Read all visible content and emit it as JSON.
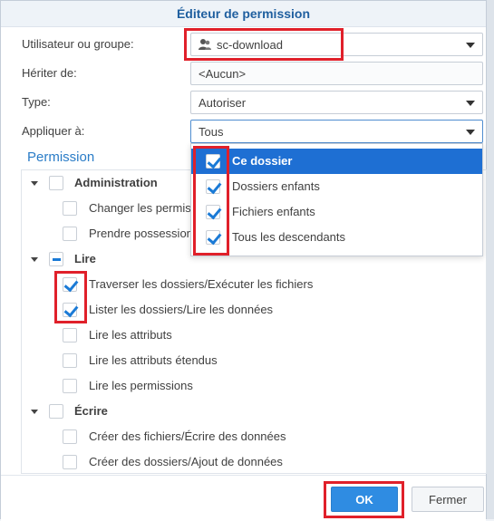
{
  "dialog": {
    "title": "Éditeur de permission"
  },
  "form": {
    "user_label": "Utilisateur ou groupe:",
    "user_value": "sc-download",
    "inherit_label": "Hériter de:",
    "inherit_value": "<Aucun>",
    "type_label": "Type:",
    "type_value": "Autoriser",
    "apply_label": "Appliquer à:",
    "apply_value": "Tous"
  },
  "apply_options": [
    {
      "label": "Ce dossier",
      "checked": true,
      "selected": true
    },
    {
      "label": "Dossiers enfants",
      "checked": true
    },
    {
      "label": "Fichiers enfants",
      "checked": true
    },
    {
      "label": "Tous les descendants",
      "checked": true
    }
  ],
  "permission": {
    "section_title": "Permission",
    "groups": [
      {
        "label": "Administration",
        "state": "unchecked",
        "items": [
          {
            "label": "Changer les permissions",
            "checked": false
          },
          {
            "label": "Prendre possession",
            "checked": false
          }
        ]
      },
      {
        "label": "Lire",
        "state": "partial",
        "items": [
          {
            "label": "Traverser les dossiers/Exécuter les fichiers",
            "checked": true
          },
          {
            "label": "Lister les dossiers/Lire les données",
            "checked": true
          },
          {
            "label": "Lire les attributs",
            "checked": false
          },
          {
            "label": "Lire les attributs étendus",
            "checked": false
          },
          {
            "label": "Lire les permissions",
            "checked": false
          }
        ]
      },
      {
        "label": "Écrire",
        "state": "unchecked",
        "items": [
          {
            "label": "Créer des fichiers/Écrire des données",
            "checked": false
          },
          {
            "label": "Créer des dossiers/Ajout de données",
            "checked": false
          }
        ]
      }
    ]
  },
  "buttons": {
    "ok": "OK",
    "close": "Fermer"
  },
  "colors": {
    "accent": "#2f8ce2",
    "highlight": "#e0202a",
    "title": "#1f5f9f"
  }
}
